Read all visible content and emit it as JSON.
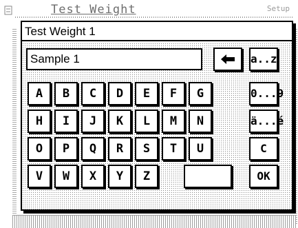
{
  "background": {
    "title": "Test Weight",
    "setup_label": "Setup"
  },
  "dialog": {
    "title": "Test Weight 1",
    "input_value": "Sample 1"
  },
  "keyboard": {
    "rows": [
      [
        "A",
        "B",
        "C",
        "D",
        "E",
        "F",
        "G"
      ],
      [
        "H",
        "I",
        "J",
        "K",
        "L",
        "M",
        "N"
      ],
      [
        "O",
        "P",
        "Q",
        "R",
        "S",
        "T",
        "U"
      ],
      [
        "V",
        "W",
        "X",
        "Y",
        "Z"
      ]
    ],
    "side_keys": {
      "lowercase": "a..z",
      "numbers": "0...9",
      "accents": "ä...é",
      "clear": "C",
      "ok": "OK"
    },
    "icons": {
      "backspace": "left-arrow-icon"
    }
  }
}
